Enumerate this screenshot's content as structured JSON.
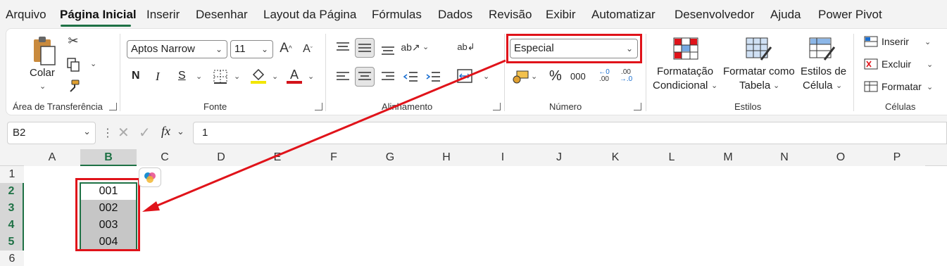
{
  "menu": {
    "tabs": [
      "Arquivo",
      "Página Inicial",
      "Inserir",
      "Desenhar",
      "Layout da Página",
      "Fórmulas",
      "Dados",
      "Revisão",
      "Exibir",
      "Automatizar",
      "Desenvolvedor",
      "Ajuda",
      "Power Pivot"
    ],
    "active": "Página Inicial"
  },
  "ribbon": {
    "clipboard": {
      "paste_label": "Colar",
      "group_label": "Área de Transferência"
    },
    "font": {
      "font_name": "Aptos Narrow",
      "font_size": "11",
      "bold": "N",
      "italic": "I",
      "underline": "S",
      "group_label": "Fonte"
    },
    "alignment": {
      "group_label": "Alinhamento"
    },
    "number": {
      "format": "Especial",
      "percent": "%",
      "thousands": "000",
      "group_label": "Número"
    },
    "styles": {
      "conditional_label_1": "Formatação",
      "conditional_label_2": "Condicional",
      "table_label_1": "Formatar como",
      "table_label_2": "Tabela",
      "cell_styles_label_1": "Estilos de",
      "cell_styles_label_2": "Célula",
      "group_label": "Estilos"
    },
    "cells": {
      "insert": "Inserir",
      "delete": "Excluir",
      "format": "Formatar",
      "group_label": "Células"
    }
  },
  "formula_bar": {
    "name_box": "B2",
    "fx": "fx",
    "value": "1"
  },
  "grid": {
    "columns": [
      "A",
      "B",
      "C",
      "D",
      "E",
      "F",
      "G",
      "H",
      "I",
      "J",
      "K",
      "L",
      "M",
      "N",
      "O",
      "P"
    ],
    "rows": [
      "1",
      "2",
      "3",
      "4",
      "5",
      "6"
    ],
    "cells": [
      "001",
      "002",
      "003",
      "004"
    ]
  },
  "colors": {
    "accent": "#1e7145",
    "highlight": "#e0131a",
    "selection": "#c6c6c6"
  }
}
